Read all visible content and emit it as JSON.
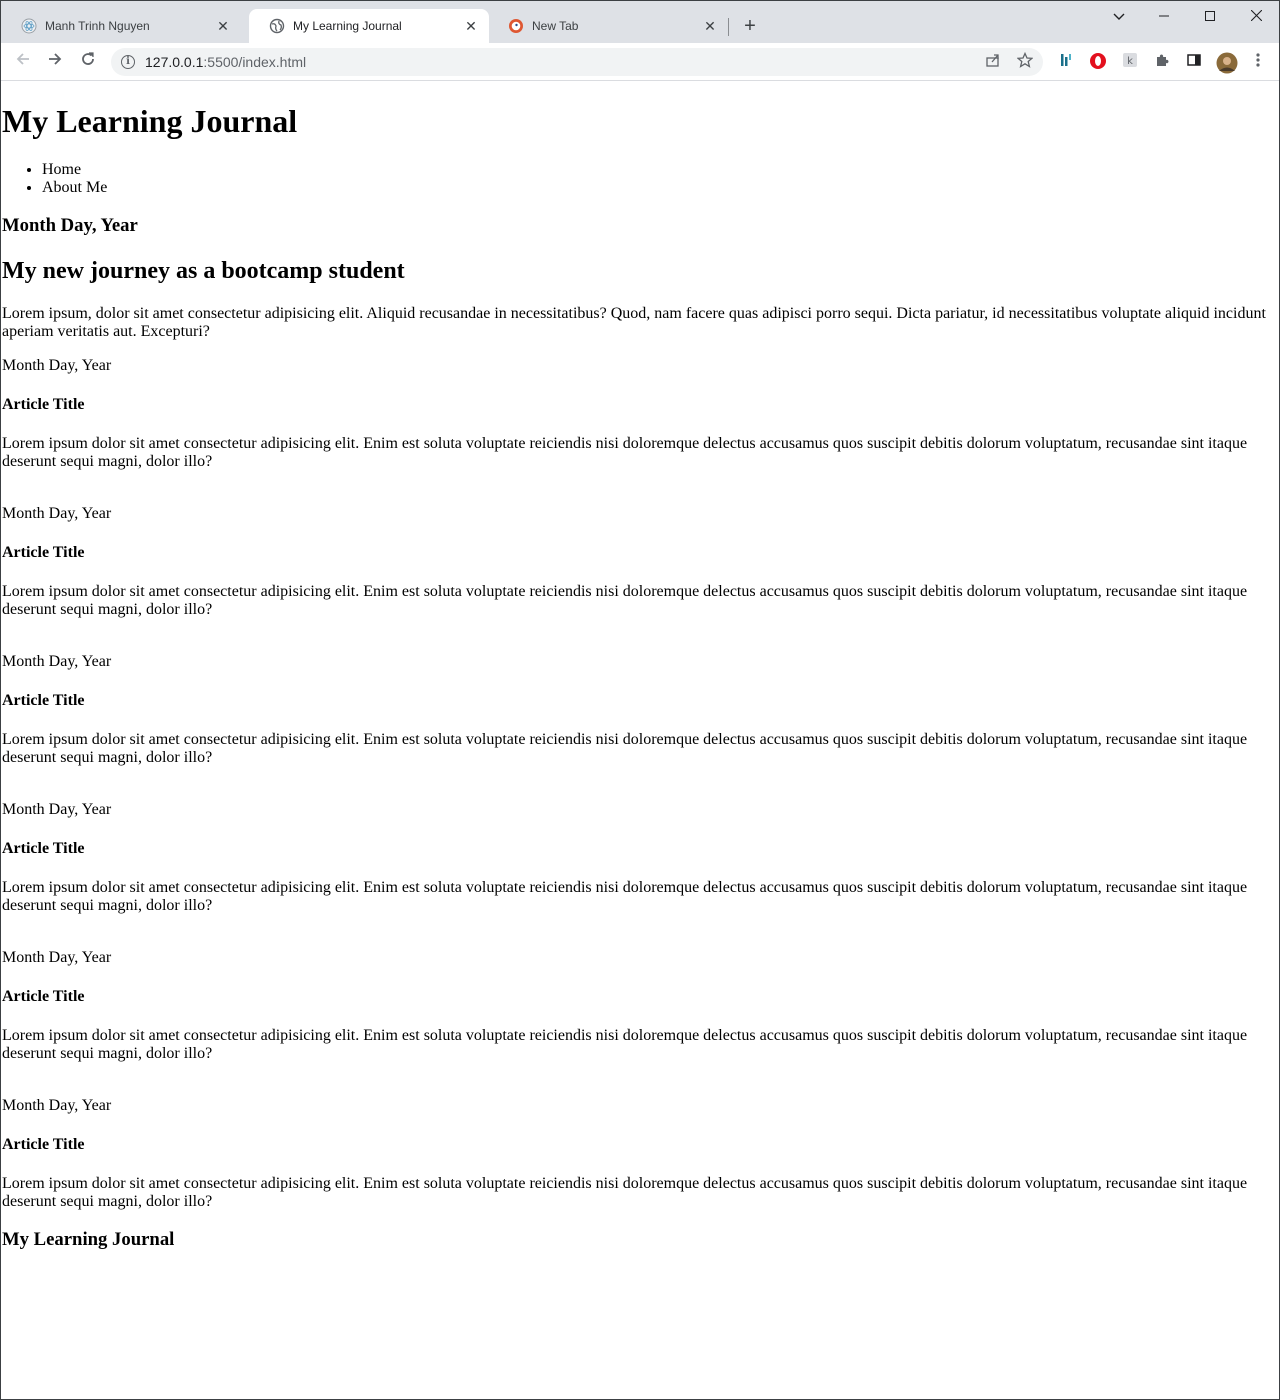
{
  "browser": {
    "tabs": [
      {
        "title": "Manh Trinh Nguyen",
        "icon": "react-icon"
      },
      {
        "title": "My Learning Journal",
        "icon": "globe-icon"
      },
      {
        "title": "New Tab",
        "icon": "duckduckgo-icon"
      }
    ],
    "url_host": "127.0.0.1",
    "url_rest": ":5500/index.html"
  },
  "page": {
    "site_title": "My Learning Journal",
    "nav": [
      "Home",
      "About Me"
    ],
    "featured": {
      "date": "Month Day, Year",
      "title": "My new journey as a bootcamp student",
      "body": "Lorem ipsum, dolor sit amet consectetur adipisicing elit. Aliquid recusandae in necessitatibus? Quod, nam facere quas adipisci porro sequi. Dicta pariatur, id necessitatibus voluptate aliquid incidunt aperiam veritatis aut. Excepturi?"
    },
    "articles": [
      {
        "date": "Month Day, Year",
        "title": "Article Title",
        "body": "Lorem ipsum dolor sit amet consectetur adipisicing elit. Enim est soluta voluptate reiciendis nisi doloremque delectus accusamus quos suscipit debitis dolorum voluptatum, recusandae sint itaque deserunt sequi magni, dolor illo?"
      },
      {
        "date": "Month Day, Year",
        "title": "Article Title",
        "body": "Lorem ipsum dolor sit amet consectetur adipisicing elit. Enim est soluta voluptate reiciendis nisi doloremque delectus accusamus quos suscipit debitis dolorum voluptatum, recusandae sint itaque deserunt sequi magni, dolor illo?"
      },
      {
        "date": "Month Day, Year",
        "title": "Article Title",
        "body": "Lorem ipsum dolor sit amet consectetur adipisicing elit. Enim est soluta voluptate reiciendis nisi doloremque delectus accusamus quos suscipit debitis dolorum voluptatum, recusandae sint itaque deserunt sequi magni, dolor illo?"
      },
      {
        "date": "Month Day, Year",
        "title": "Article Title",
        "body": "Lorem ipsum dolor sit amet consectetur adipisicing elit. Enim est soluta voluptate reiciendis nisi doloremque delectus accusamus quos suscipit debitis dolorum voluptatum, recusandae sint itaque deserunt sequi magni, dolor illo?"
      },
      {
        "date": "Month Day, Year",
        "title": "Article Title",
        "body": "Lorem ipsum dolor sit amet consectetur adipisicing elit. Enim est soluta voluptate reiciendis nisi doloremque delectus accusamus quos suscipit debitis dolorum voluptatum, recusandae sint itaque deserunt sequi magni, dolor illo?"
      },
      {
        "date": "Month Day, Year",
        "title": "Article Title",
        "body": "Lorem ipsum dolor sit amet consectetur adipisicing elit. Enim est soluta voluptate reiciendis nisi doloremque delectus accusamus quos suscipit debitis dolorum voluptatum, recusandae sint itaque deserunt sequi magni, dolor illo?"
      }
    ],
    "footer_title": "My Learning Journal"
  },
  "colors": {
    "tabstrip": "#dee1e6",
    "omnibox": "#f1f3f4",
    "opera_red": "#e3101e",
    "ext_teal": "#1a6f8a"
  }
}
